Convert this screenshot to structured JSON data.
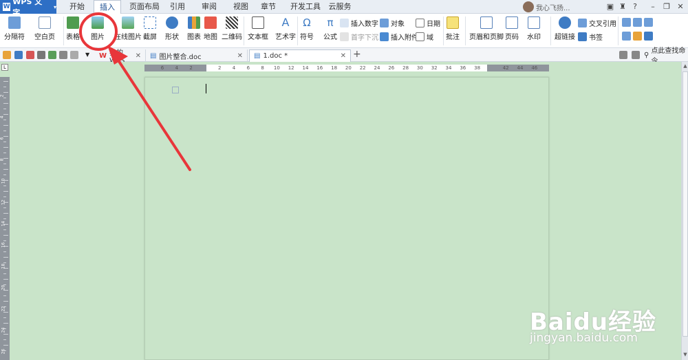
{
  "app": {
    "name": "WPS 文字"
  },
  "menu": {
    "tabs": [
      "开始",
      "插入",
      "页面布局",
      "引用",
      "审阅",
      "视图",
      "章节",
      "开发工具",
      "云服务"
    ],
    "active": "插入"
  },
  "account": {
    "name": "我心飞扬..."
  },
  "ribbon": {
    "big": [
      "分隔符",
      "空白页",
      "表格",
      "图片",
      "在线图片",
      "截屏",
      "形状",
      "图表",
      "地图",
      "二维码",
      "文本框",
      "艺术字",
      "符号",
      "公式",
      "批注",
      "页眉和页脚",
      "页码",
      "水印",
      "超链接"
    ],
    "small": {
      "insert_number": "插入数字",
      "object": "对象",
      "date": "日期",
      "drop_cap": "首字下沉",
      "attachment": "插入附件",
      "field": "域",
      "cross_ref": "交叉引用",
      "bookmark": "书签"
    }
  },
  "doc_tabs": [
    {
      "label": "我的WPS"
    },
    {
      "label": "图片整合.doc"
    },
    {
      "label": "1.doc *"
    }
  ],
  "search": {
    "label": "点此查找命令"
  },
  "ruler": {
    "numbers": [
      "6",
      "4",
      "2",
      "",
      "2",
      "4",
      "6",
      "8",
      "10",
      "12",
      "14",
      "16",
      "18",
      "20",
      "22",
      "24",
      "26",
      "28",
      "30",
      "32",
      "34",
      "36",
      "38",
      "",
      "42",
      "44",
      "46"
    ]
  },
  "vruler": {
    "numbers": [
      "2",
      "4",
      "6",
      "8",
      "10",
      "12",
      "14",
      "16",
      "18",
      "20",
      "22",
      "24",
      "26"
    ]
  },
  "watermark": {
    "brand": "Baidu经验",
    "url": "jingyan.baidu.com"
  },
  "colors": {
    "accent": "#2e6fc5",
    "page_bg": "#c9e4c9",
    "annotation": "#e8363a"
  }
}
